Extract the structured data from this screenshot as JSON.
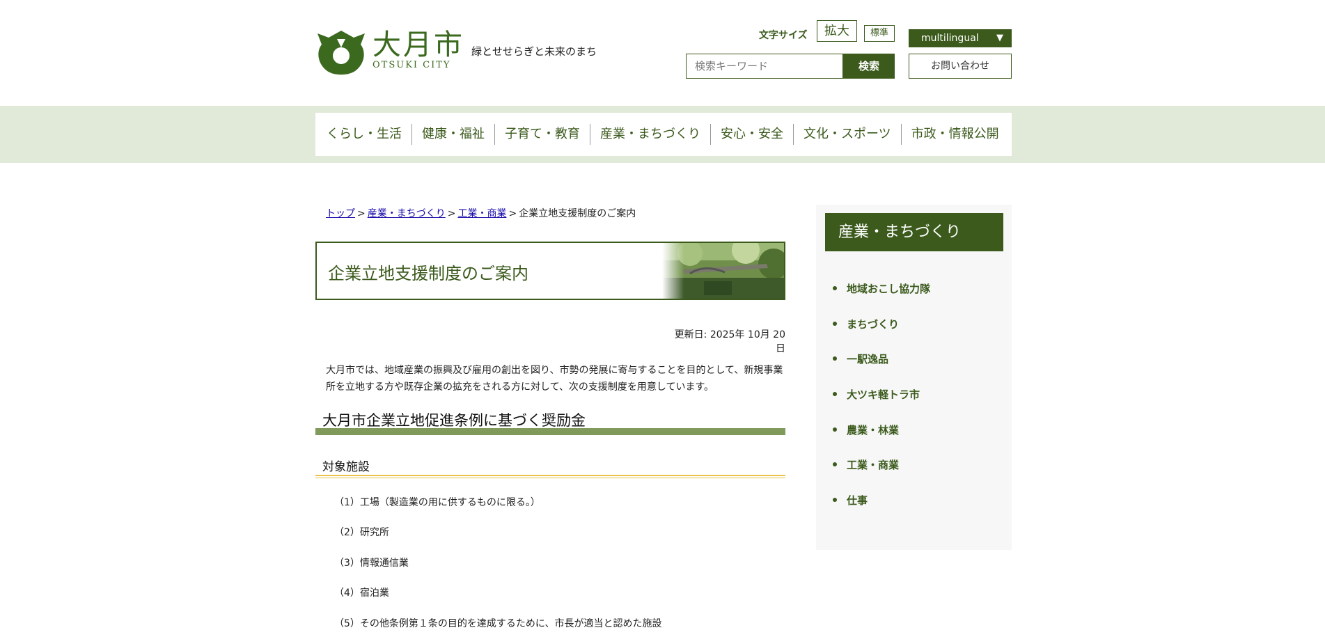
{
  "site": {
    "name_jp": "大月市",
    "name_en": "OTSUKI CITY",
    "tagline": "緑とせせらぎと未来のまち"
  },
  "utility": {
    "font_size_label": "文字サイズ",
    "enlarge_label": "拡大",
    "standard_label": "標準",
    "multilingual_label": "multilingual",
    "search_placeholder": "検索キーワード",
    "search_button": "検索",
    "contact_button": "お問い合わせ"
  },
  "nav": {
    "items": [
      {
        "label": "くらし・生活"
      },
      {
        "label": "健康・福祉"
      },
      {
        "label": "子育て・教育"
      },
      {
        "label": "産業・まちづくり"
      },
      {
        "label": "安心・安全"
      },
      {
        "label": "文化・スポーツ"
      },
      {
        "label": "市政・情報公開"
      }
    ]
  },
  "breadcrumb": {
    "top": "トップ",
    "level1": "産業・まちづくり",
    "level2": "工業・商業",
    "current": "企業立地支援制度のご案内",
    "separator": ">"
  },
  "page": {
    "title": "企業立地支援制度のご案内",
    "updated": "更新日: 2025年 10月 20日",
    "intro": "大月市では、地域産業の振興及び雇用の創出を図り、市勢の発展に寄与することを目的として、新規事業所を立地する方や既存企業の拡充をされる方に対して、次の支援制度を用意しています。",
    "h2": "大月市企業立地促進条例に基づく奨励金",
    "h3": "対象施設",
    "facilities": [
      "（1）工場（製造業の用に供するものに限る。）",
      "（2）研究所",
      "（3）情報通信業",
      "（4）宿泊業",
      "（5）その他条例第１条の目的を達成するために、市長が適当と認めた施設"
    ]
  },
  "sidebar": {
    "heading": "産業・まちづくり",
    "items": [
      "地域おこし協力隊",
      "まちづくり",
      "一駅逸品",
      "大ツキ軽トラ市",
      "農業・林業",
      "工業・商業",
      "仕事"
    ]
  },
  "colors": {
    "brand_green": "#3b5a1c",
    "nav_band": "#e1ead9",
    "h2_bar": "#7f9a5a",
    "h3_line": "#e8c24a",
    "link": "#1a0dab"
  }
}
